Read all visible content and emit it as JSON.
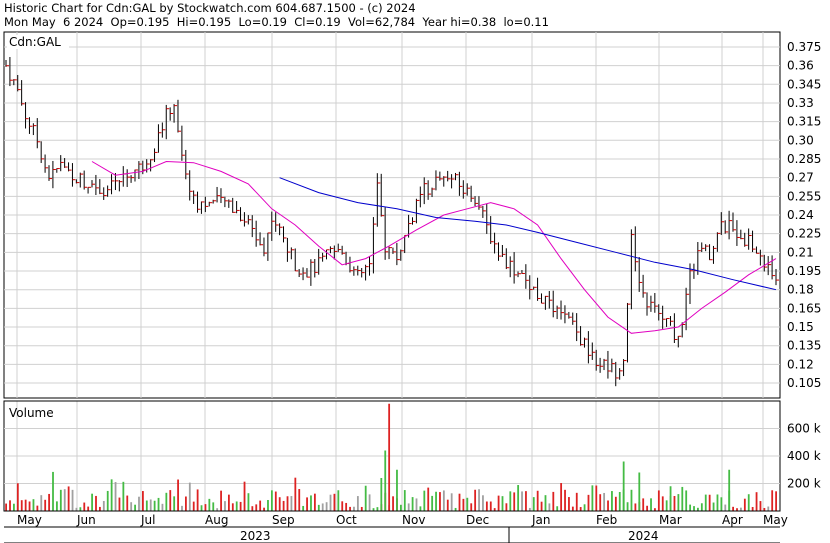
{
  "header": {
    "line1": "Historic Chart for Cdn:GAL by Stockwatch.com 604.687.1500 - (c) 2024",
    "line2": "Mon May  6 2024  Op=0.195  Hi=0.195  Lo=0.19  Cl=0.19  Vol=62,784  Year hi=0.38  lo=0.11"
  },
  "chart_data": {
    "type": "bar",
    "symbol_label": "Cdn:GAL",
    "volume_label": "Volume",
    "grid": true,
    "price_ticks": [
      "0.375",
      "0.36",
      "0.345",
      "0.33",
      "0.315",
      "0.30",
      "0.285",
      "0.27",
      "0.255",
      "0.24",
      "0.225",
      "0.21",
      "0.195",
      "0.18",
      "0.165",
      "0.15",
      "0.135",
      "0.12",
      "0.105"
    ],
    "price_ylim": [
      0.093,
      0.387
    ],
    "volume_ticks": [
      "600 k",
      "400 k",
      "200 k"
    ],
    "volume_ylim": [
      0,
      800000
    ],
    "months": [
      "May",
      "Jun",
      "Jul",
      "Aug",
      "Sep",
      "Oct",
      "Nov",
      "Dec",
      "Jan",
      "Feb",
      "Mar",
      "Apr",
      "May"
    ],
    "years": [
      "2023",
      "2024"
    ],
    "price_anchors": [
      [
        0,
        0.36
      ],
      [
        3,
        0.34
      ],
      [
        5,
        0.32
      ],
      [
        8,
        0.3
      ],
      [
        11,
        0.27
      ],
      [
        14,
        0.28
      ],
      [
        18,
        0.27
      ],
      [
        22,
        0.265
      ],
      [
        26,
        0.26
      ],
      [
        30,
        0.27
      ],
      [
        35,
        0.28
      ],
      [
        38,
        0.295
      ],
      [
        41,
        0.32
      ],
      [
        43,
        0.33
      ],
      [
        46,
        0.27
      ],
      [
        49,
        0.25
      ],
      [
        53,
        0.25
      ],
      [
        57,
        0.25
      ],
      [
        60,
        0.24
      ],
      [
        63,
        0.23
      ],
      [
        66,
        0.21
      ],
      [
        68,
        0.24
      ],
      [
        71,
        0.22
      ],
      [
        74,
        0.2
      ],
      [
        77,
        0.195
      ],
      [
        80,
        0.2
      ],
      [
        83,
        0.21
      ],
      [
        86,
        0.21
      ],
      [
        88,
        0.2
      ],
      [
        90,
        0.19
      ],
      [
        93,
        0.2
      ],
      [
        95,
        0.26
      ],
      [
        97,
        0.215
      ],
      [
        100,
        0.205
      ],
      [
        104,
        0.24
      ],
      [
        107,
        0.26
      ],
      [
        111,
        0.27
      ],
      [
        114,
        0.27
      ],
      [
        117,
        0.26
      ],
      [
        120,
        0.255
      ],
      [
        123,
        0.23
      ],
      [
        126,
        0.21
      ],
      [
        129,
        0.2
      ],
      [
        132,
        0.19
      ],
      [
        135,
        0.18
      ],
      [
        138,
        0.17
      ],
      [
        141,
        0.16
      ],
      [
        144,
        0.155
      ],
      [
        147,
        0.14
      ],
      [
        150,
        0.125
      ],
      [
        153,
        0.12
      ],
      [
        156,
        0.115
      ],
      [
        158,
        0.125
      ],
      [
        160,
        0.22
      ],
      [
        162,
        0.18
      ],
      [
        164,
        0.17
      ],
      [
        167,
        0.16
      ],
      [
        170,
        0.15
      ],
      [
        172,
        0.14
      ],
      [
        175,
        0.19
      ],
      [
        177,
        0.21
      ],
      [
        180,
        0.21
      ],
      [
        183,
        0.23
      ],
      [
        185,
        0.23
      ],
      [
        188,
        0.225
      ],
      [
        191,
        0.215
      ],
      [
        194,
        0.2
      ],
      [
        197,
        0.19
      ]
    ],
    "ma_short": [
      [
        22,
        0.283
      ],
      [
        28,
        0.272
      ],
      [
        35,
        0.275
      ],
      [
        41,
        0.283
      ],
      [
        48,
        0.282
      ],
      [
        55,
        0.275
      ],
      [
        62,
        0.265
      ],
      [
        68,
        0.245
      ],
      [
        74,
        0.232
      ],
      [
        80,
        0.215
      ],
      [
        86,
        0.2
      ],
      [
        92,
        0.205
      ],
      [
        98,
        0.215
      ],
      [
        105,
        0.228
      ],
      [
        112,
        0.24
      ],
      [
        118,
        0.245
      ],
      [
        124,
        0.25
      ],
      [
        130,
        0.245
      ],
      [
        136,
        0.232
      ],
      [
        142,
        0.205
      ],
      [
        148,
        0.18
      ],
      [
        154,
        0.158
      ],
      [
        160,
        0.145
      ],
      [
        166,
        0.147
      ],
      [
        172,
        0.15
      ],
      [
        178,
        0.165
      ],
      [
        184,
        0.178
      ],
      [
        190,
        0.192
      ],
      [
        197,
        0.205
      ]
    ],
    "ma_long": [
      [
        70,
        0.27
      ],
      [
        80,
        0.258
      ],
      [
        90,
        0.25
      ],
      [
        100,
        0.245
      ],
      [
        110,
        0.238
      ],
      [
        120,
        0.235
      ],
      [
        128,
        0.232
      ],
      [
        136,
        0.226
      ],
      [
        146,
        0.218
      ],
      [
        156,
        0.21
      ],
      [
        166,
        0.202
      ],
      [
        176,
        0.196
      ],
      [
        186,
        0.188
      ],
      [
        197,
        0.18
      ]
    ]
  }
}
